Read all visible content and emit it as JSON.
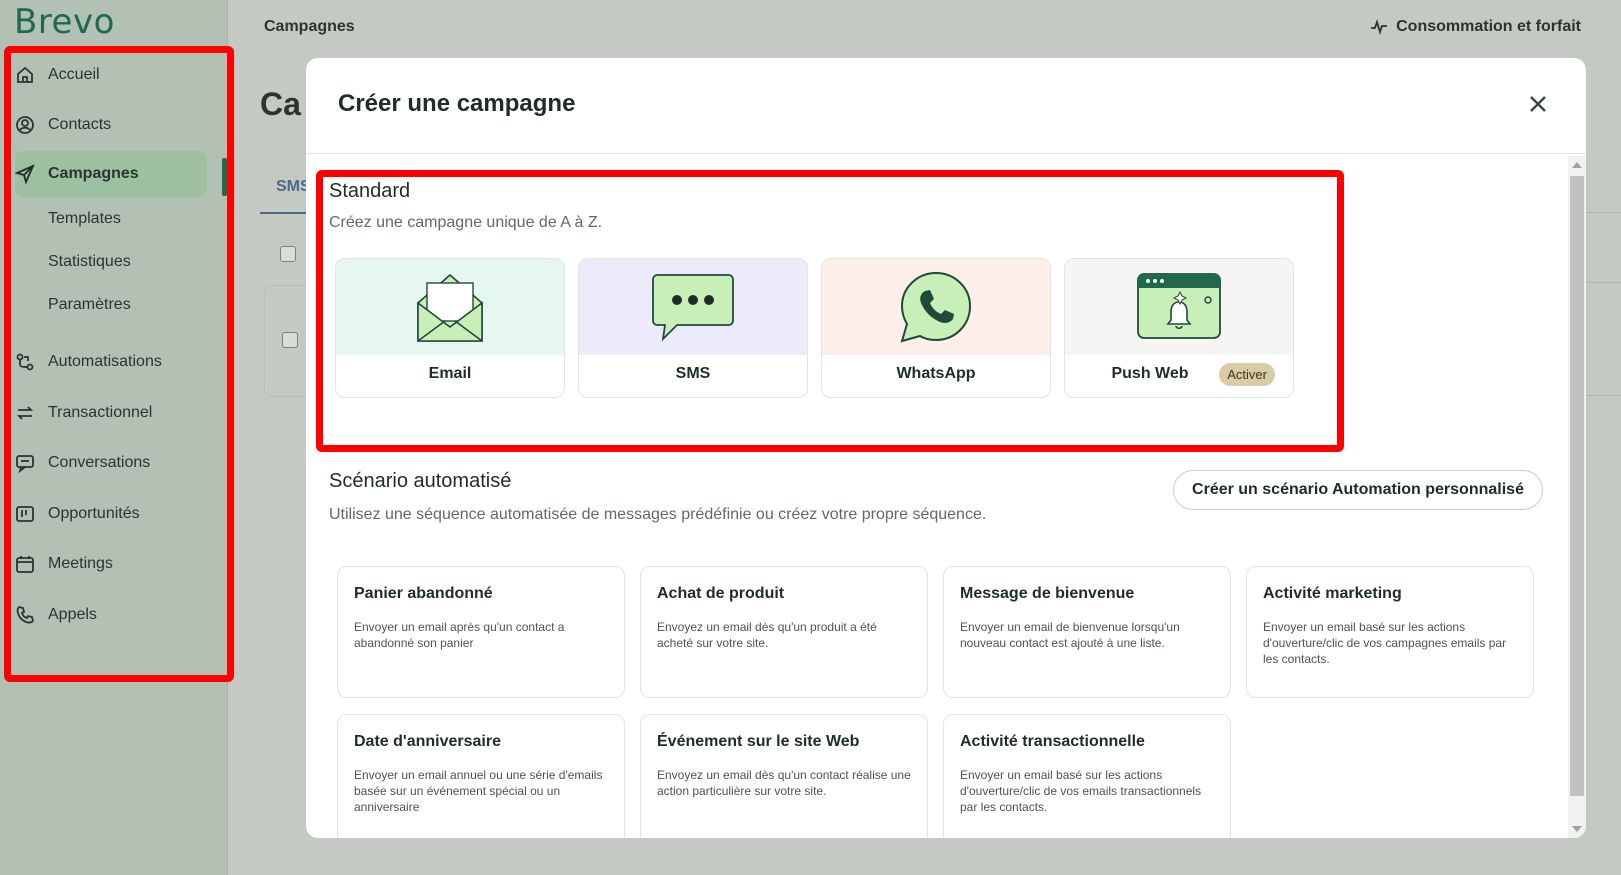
{
  "app": {
    "logo": "Brevo"
  },
  "sidebar": {
    "items": [
      {
        "label": "Accueil",
        "icon": "home-icon"
      },
      {
        "label": "Contacts",
        "icon": "user-circle-icon"
      },
      {
        "label": "Campagnes",
        "icon": "send-icon",
        "active": true
      },
      {
        "label": "Automatisations",
        "icon": "automation-icon"
      },
      {
        "label": "Transactionnel",
        "icon": "arrows-exchange-icon"
      },
      {
        "label": "Conversations",
        "icon": "chat-icon"
      },
      {
        "label": "Opportunités",
        "icon": "pipeline-icon"
      },
      {
        "label": "Meetings",
        "icon": "calendar-icon"
      },
      {
        "label": "Appels",
        "icon": "phone-icon"
      }
    ],
    "subitems": [
      "Templates",
      "Statistiques",
      "Paramètres"
    ]
  },
  "topbar": {
    "title": "Campagnes",
    "right_label": "Consommation et forfait"
  },
  "background": {
    "page_title": "Ca",
    "tab": "SMS"
  },
  "modal": {
    "title": "Créer une campagne",
    "standard": {
      "title": "Standard",
      "subtitle": "Créez une campagne unique de A à Z.",
      "channels": [
        {
          "label": "Email",
          "bg": "#e6f6f1"
        },
        {
          "label": "SMS",
          "bg": "#ebebfb"
        },
        {
          "label": "WhatsApp",
          "bg": "#fdeeea"
        },
        {
          "label": "Push Web",
          "bg": "#f5f5f3",
          "badge": "Activer"
        }
      ]
    },
    "automation": {
      "title": "Scénario automatisé",
      "subtitle": "Utilisez une séquence automatisée de messages prédéfinie ou créez votre propre séquence.",
      "button": "Créer un scénario Automation personnalisé",
      "cards": [
        {
          "title": "Panier abandonné",
          "desc": "Envoyer un email après qu'un contact a abandonné son panier"
        },
        {
          "title": "Achat de produit",
          "desc": "Envoyez un email dès qu'un produit a été acheté sur votre site."
        },
        {
          "title": "Message de bienvenue",
          "desc": "Envoyer un email de bienvenue lorsqu'un nouveau contact est ajouté à une liste."
        },
        {
          "title": "Activité marketing",
          "desc": "Envoyer un email basé sur les actions d'ouverture/clic de vos campagnes emails par les contacts."
        },
        {
          "title": "Date d'anniversaire",
          "desc": "Envoyer un email annuel ou une série d'emails basée sur un événement spécial ou un anniversaire"
        },
        {
          "title": "Événement sur le site Web",
          "desc": "Envoyez un email dès qu'un contact réalise une action particulière sur votre site."
        },
        {
          "title": "Activité transactionnelle",
          "desc": "Envoyer un email basé sur les actions d'ouverture/clic de vos emails transactionnels par les contacts."
        }
      ]
    }
  },
  "colors": {
    "brand": "#1f6a4d",
    "highlight": "#ff0000"
  }
}
